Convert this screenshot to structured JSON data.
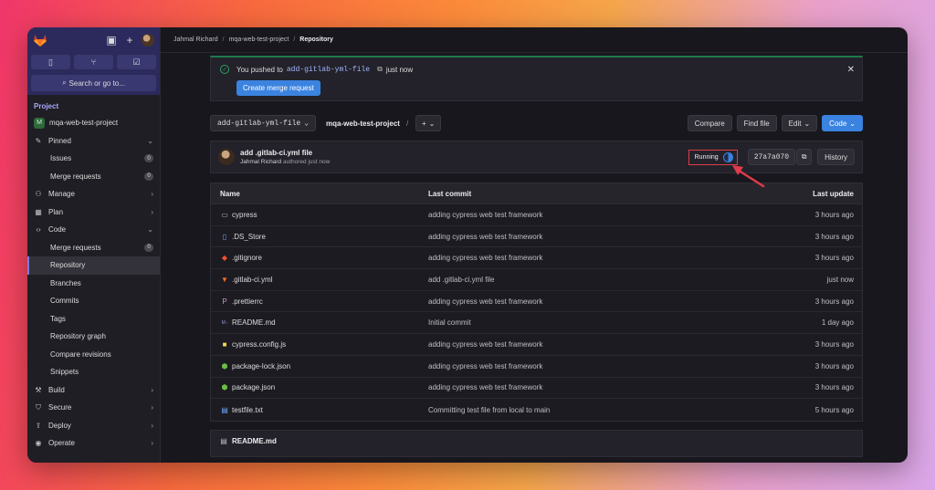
{
  "breadcrumb": [
    "Jahmal Richard",
    "mqa-web-test-project",
    "Repository"
  ],
  "sidebar": {
    "search_label": "Search or go to...",
    "section_label": "Project",
    "project_initial": "M",
    "project_name": "mqa-web-test-project",
    "items": [
      {
        "label": "Pinned",
        "icon": "pin-icon"
      },
      {
        "label": "Issues",
        "count": "0"
      },
      {
        "label": "Merge requests",
        "count": "0"
      },
      {
        "label": "Manage",
        "icon": "manage-icon"
      },
      {
        "label": "Plan",
        "icon": "plan-icon"
      },
      {
        "label": "Code",
        "icon": "code-icon"
      },
      {
        "label": "Merge requests",
        "count": "0"
      },
      {
        "label": "Repository"
      },
      {
        "label": "Branches"
      },
      {
        "label": "Commits"
      },
      {
        "label": "Tags"
      },
      {
        "label": "Repository graph"
      },
      {
        "label": "Compare revisions"
      },
      {
        "label": "Snippets"
      },
      {
        "label": "Build",
        "icon": "build-icon"
      },
      {
        "label": "Secure",
        "icon": "shield-icon"
      },
      {
        "label": "Deploy",
        "icon": "deploy-icon"
      },
      {
        "label": "Operate",
        "icon": "operate-icon"
      }
    ]
  },
  "alert": {
    "prefix": "You pushed to",
    "branch": "add-gitlab-yml-file",
    "suffix": "just now",
    "button": "Create merge request"
  },
  "nav": {
    "branch": "add-gitlab-yml-file",
    "project_path": "mqa-web-test-project",
    "compare": "Compare",
    "find_file": "Find file",
    "edit": "Edit",
    "code": "Code"
  },
  "commit": {
    "title": "add .gitlab-ci.yml file",
    "author": "Jahmal Richard",
    "authored": "authored just now",
    "status": "Running",
    "sha": "27a7a070",
    "history": "History"
  },
  "table": {
    "headers": [
      "Name",
      "Last commit",
      "Last update"
    ],
    "rows": [
      {
        "name": "cypress",
        "icon": "folder-icon",
        "commit": "adding cypress web test framework",
        "date": "3 hours ago"
      },
      {
        "name": ".DS_Store",
        "icon": "file-icon",
        "commit": "adding cypress web test framework",
        "date": "3 hours ago"
      },
      {
        "name": ".gitignore",
        "icon": "git-icon",
        "commit": "adding cypress web test framework",
        "date": "3 hours ago"
      },
      {
        "name": ".gitlab-ci.yml",
        "icon": "gitlab-icon",
        "commit": "add .gitlab-ci.yml file",
        "date": "just now"
      },
      {
        "name": ".prettierrc",
        "icon": "prettier-icon",
        "commit": "adding cypress web test framework",
        "date": "3 hours ago"
      },
      {
        "name": "README.md",
        "icon": "markdown-icon",
        "commit": "Initial commit",
        "date": "1 day ago"
      },
      {
        "name": "cypress.config.js",
        "icon": "js-icon",
        "commit": "adding cypress web test framework",
        "date": "3 hours ago"
      },
      {
        "name": "package-lock.json",
        "icon": "node-icon",
        "commit": "adding cypress web test framework",
        "date": "3 hours ago"
      },
      {
        "name": "package.json",
        "icon": "node-icon",
        "commit": "adding cypress web test framework",
        "date": "3 hours ago"
      },
      {
        "name": "testfile.txt",
        "icon": "text-file-icon",
        "commit": "Committing test file from local to main",
        "date": "5 hours ago"
      }
    ]
  },
  "readme": {
    "title": "README.md"
  },
  "colors": {
    "accent": "#3b83e0",
    "highlight": "#e03b4a",
    "sidebar_header": "#2c2a5c"
  }
}
